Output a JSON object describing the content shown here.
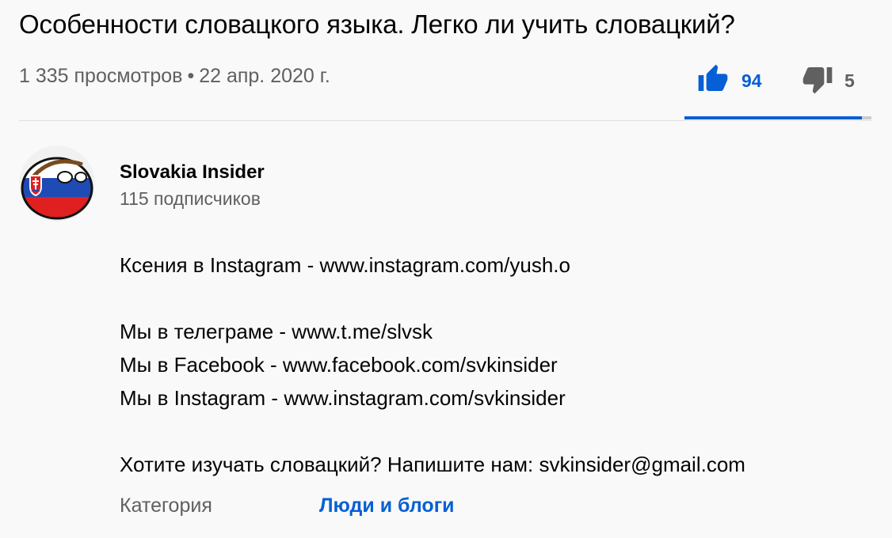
{
  "video": {
    "title": "Особенности словацкого языка. Легко ли учить словацкий?",
    "views": "1 335 просмотров",
    "separator": "•",
    "date": "22 апр. 2020 г."
  },
  "ratings": {
    "likes": "94",
    "dislikes": "5",
    "like_ratio": 0.95,
    "like_icon": "thumb-up-icon",
    "dislike_icon": "thumb-down-icon",
    "like_color": "#065fd4",
    "dislike_color": "#606060"
  },
  "channel": {
    "name": "Slovakia Insider",
    "subscribers": "115 подписчиков"
  },
  "description": {
    "lines": [
      "Ксения в Instagram - www.instagram.com/yush.o",
      "",
      "Мы в телеграме - www.t.me/slvsk",
      "Мы в Facebook - www.facebook.com/svkinsider",
      "Мы в Instagram - www.instagram.com/svkinsider",
      "",
      "Хотите изучать словацкий? Напишите нам: svkinsider@gmail.com"
    ]
  },
  "category": {
    "label": "Категория",
    "value": "Люди и блоги"
  }
}
